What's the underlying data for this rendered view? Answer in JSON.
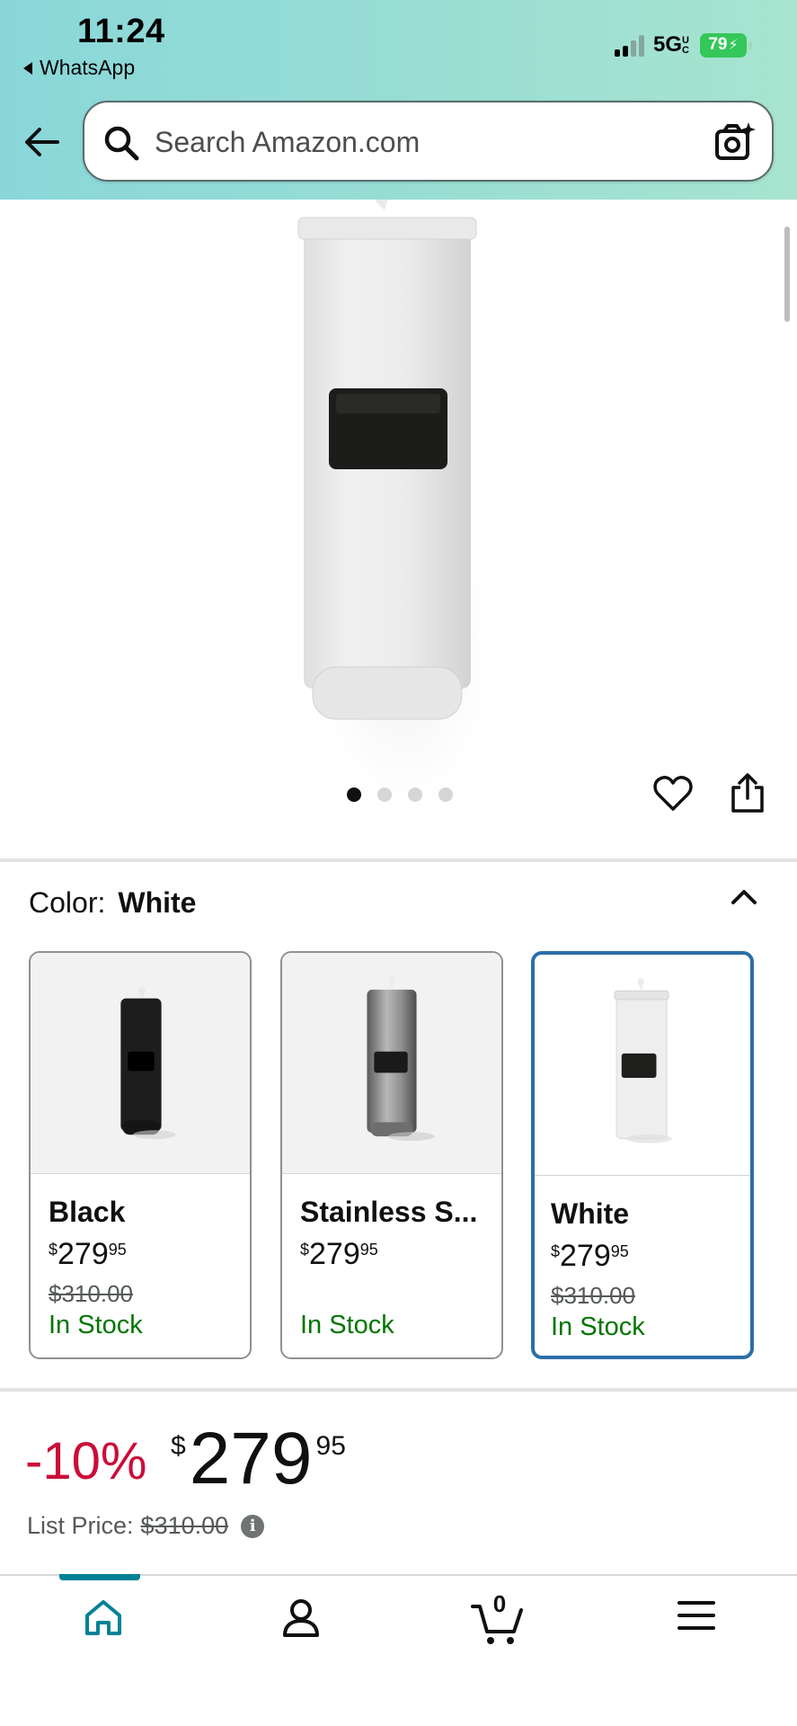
{
  "status_bar": {
    "time": "11:24",
    "back_app": "WhatsApp",
    "network": "5G",
    "network_suffix": "UC",
    "battery": "79"
  },
  "search": {
    "placeholder": "Search Amazon.com"
  },
  "gallery": {
    "dots_total": 4,
    "active_dot": 1
  },
  "color_selector": {
    "label": "Color:",
    "selected": "White",
    "options": [
      {
        "name": "Black",
        "price_symbol": "$",
        "price_whole": "279",
        "price_cents": "95",
        "list_price": "$310.00",
        "stock": "In Stock"
      },
      {
        "name": "Stainless S...",
        "price_symbol": "$",
        "price_whole": "279",
        "price_cents": "95",
        "list_price": "",
        "stock": "In Stock"
      },
      {
        "name": "White",
        "price_symbol": "$",
        "price_whole": "279",
        "price_cents": "95",
        "list_price": "$310.00",
        "stock": "In Stock"
      }
    ]
  },
  "price_block": {
    "discount": "-10%",
    "symbol": "$",
    "whole": "279",
    "cents": "95",
    "list_label": "List Price:",
    "list_value": "$310.00",
    "info_glyph": "i"
  },
  "tabbar": {
    "tabs": [
      "home-icon",
      "account-icon",
      "cart-icon",
      "menu-icon"
    ],
    "cart_count": "0",
    "active_tab": "home"
  },
  "colors": {
    "accent_teal": "#008296",
    "discount_red": "#cc0c39",
    "in_stock_green": "#007600",
    "selected_border": "#2a6fa8",
    "battery_green": "#34c759"
  }
}
